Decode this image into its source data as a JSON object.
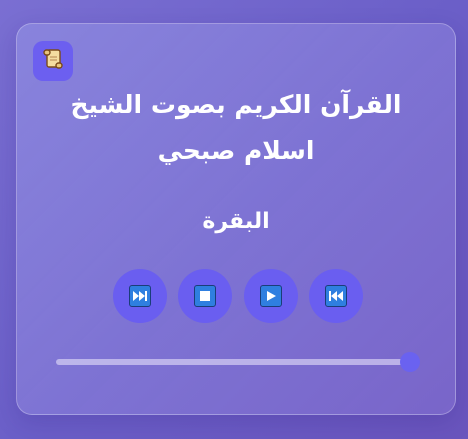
{
  "player": {
    "title_line1": "القرآن الكريم بصوت الشيخ",
    "title_line2": "اسلام صبحي",
    "surah": "البقرة",
    "badge_icon": "scroll-icon",
    "controls": [
      {
        "name": "previous-track-button",
        "icon": "previous-track-icon"
      },
      {
        "name": "play-button",
        "icon": "play-icon"
      },
      {
        "name": "stop-button",
        "icon": "stop-icon"
      },
      {
        "name": "next-track-button",
        "icon": "next-track-icon"
      }
    ],
    "progress": 1.0,
    "colors": {
      "accent": "#6a5ef0",
      "icon_fill": "#2f7fe0",
      "text": "#ffffff"
    }
  }
}
